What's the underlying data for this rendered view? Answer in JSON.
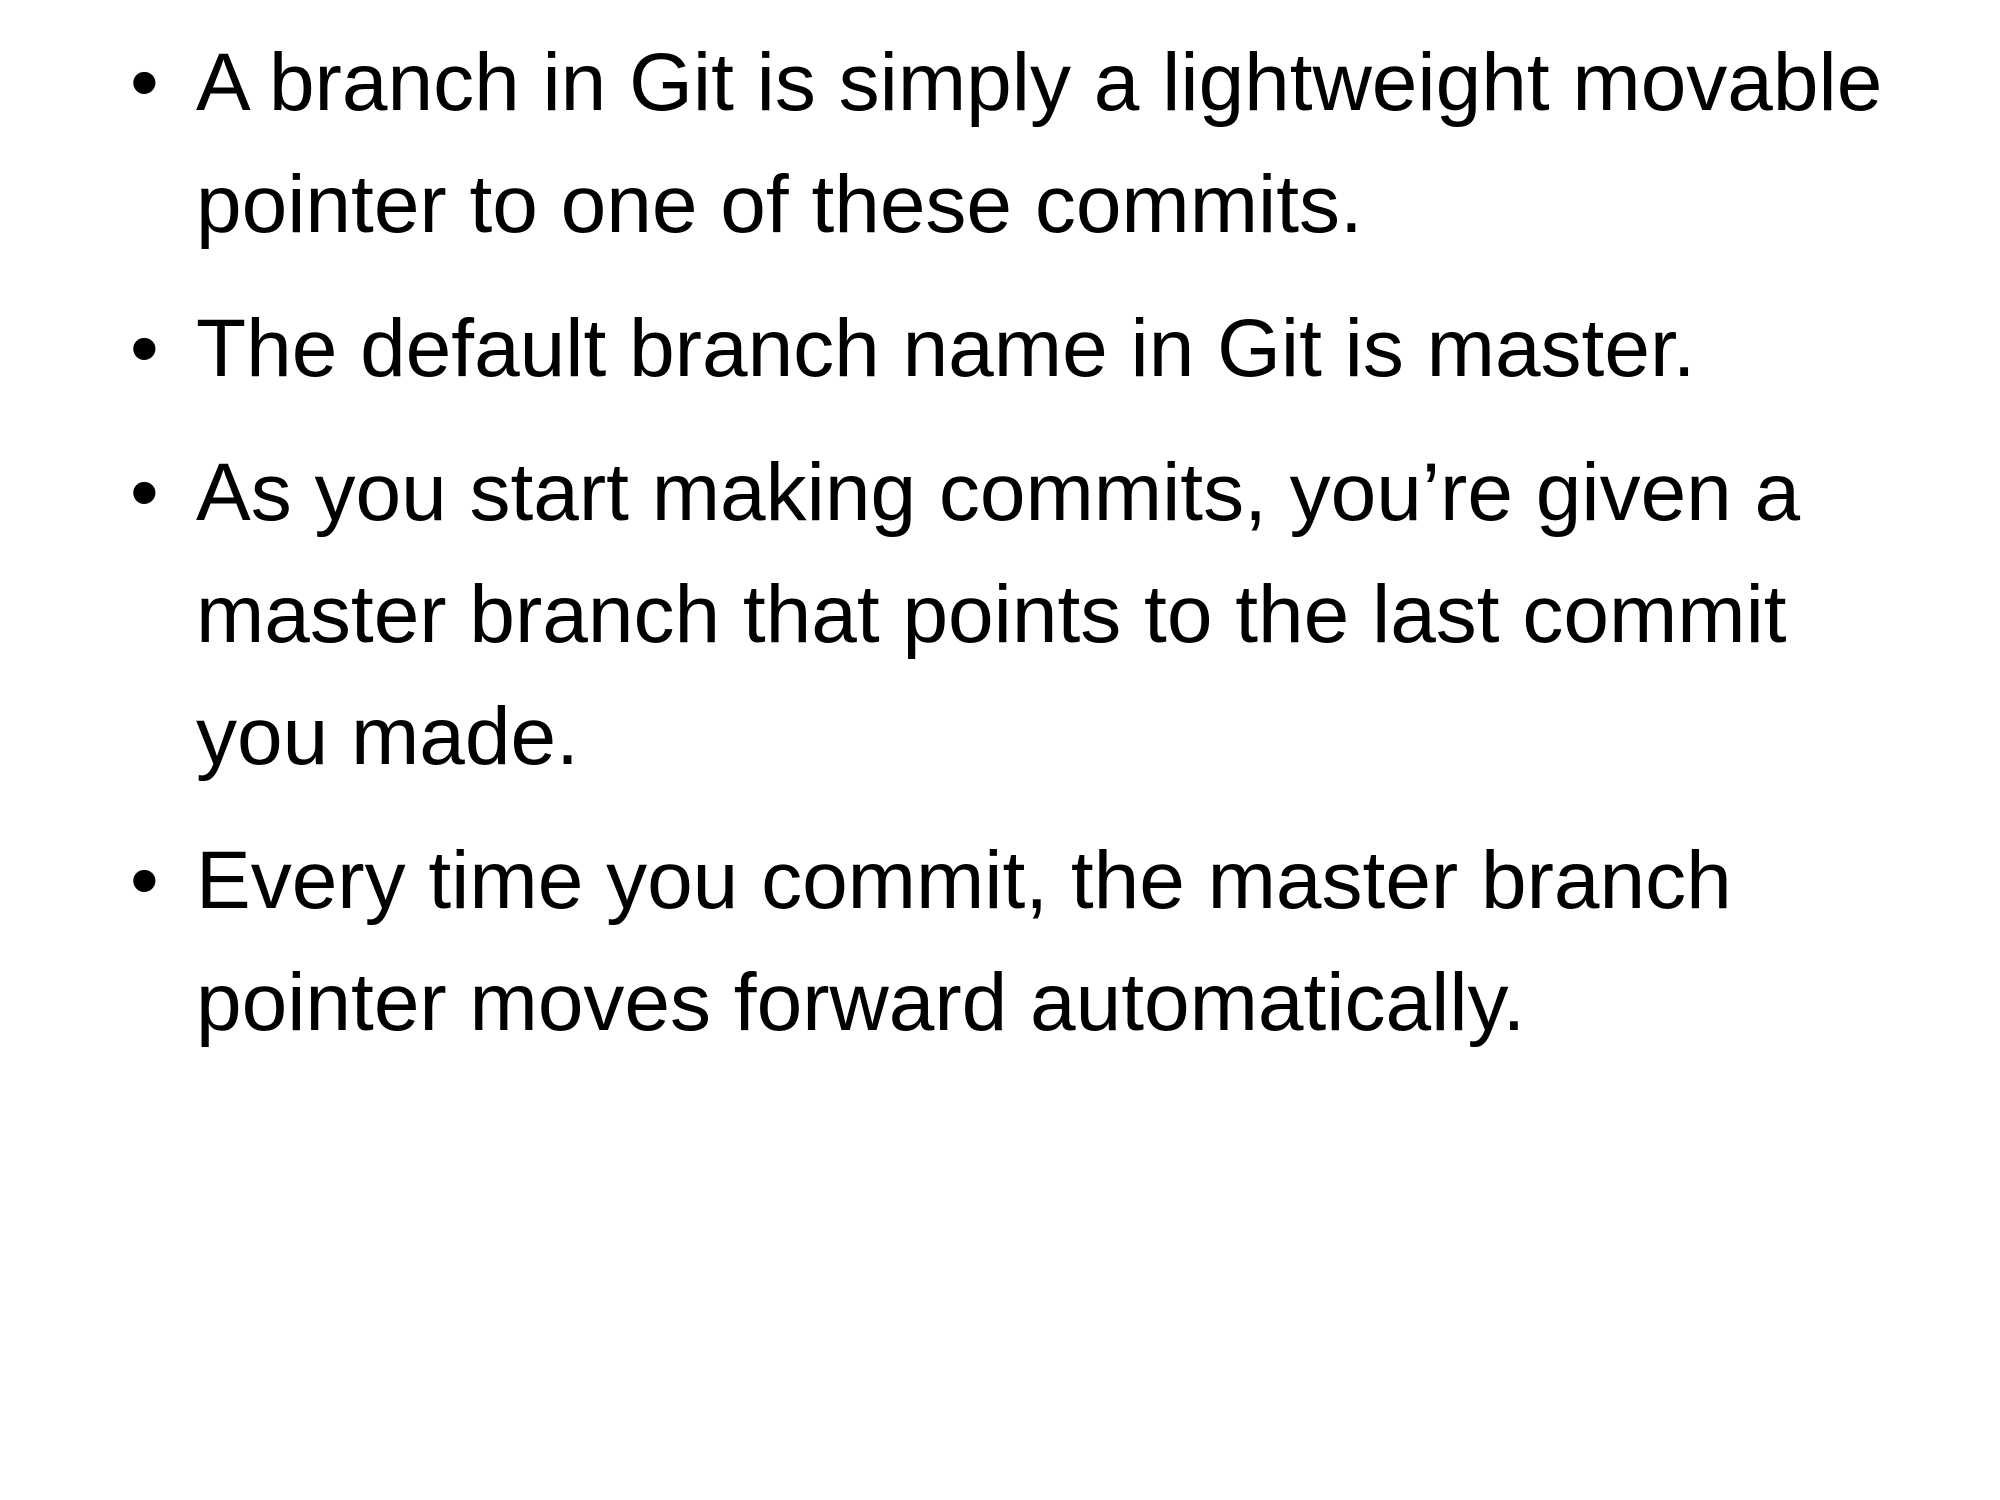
{
  "slide": {
    "bullet_glyph": "•",
    "bullets": [
      {
        "text": "A branch in Git is simply a lightweight movable pointer to one of these commits."
      },
      {
        "text": "The default branch name in Git is master."
      },
      {
        "text": "As you start making commits, you’re given a master branch that points to the last commit you made."
      },
      {
        "text": "Every time you commit, the master branch pointer moves forward automatically."
      }
    ]
  }
}
